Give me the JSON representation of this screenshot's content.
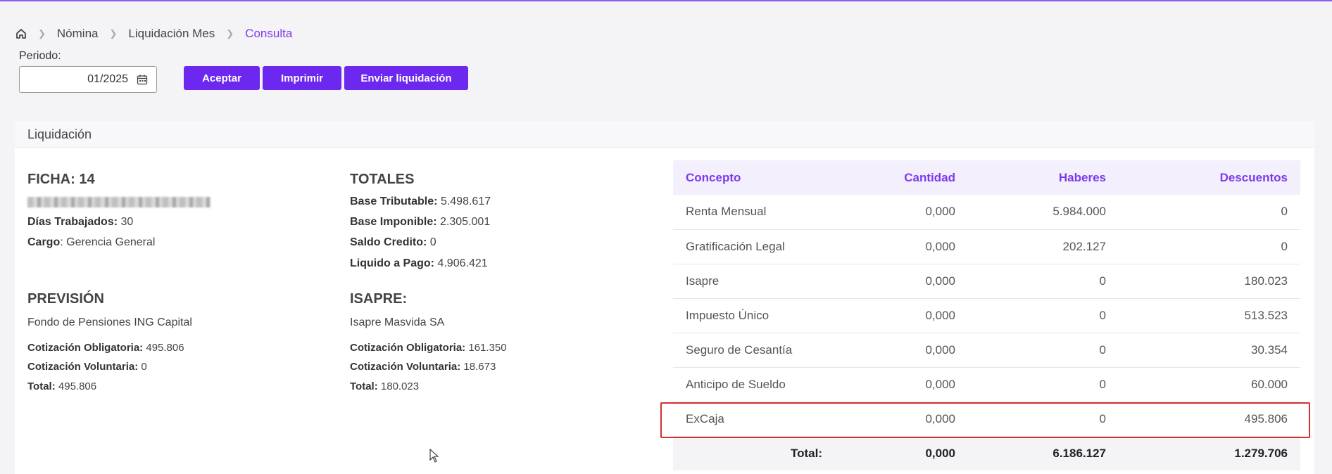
{
  "breadcrumb": {
    "items": [
      "Nómina",
      "Liquidación Mes"
    ],
    "current": "Consulta"
  },
  "periodo": {
    "label": "Periodo:",
    "value": "01/2025"
  },
  "buttons": {
    "aceptar": "Aceptar",
    "imprimir": "Imprimir",
    "enviar": "Enviar liquidación"
  },
  "card": {
    "title": "Liquidación"
  },
  "ficha": {
    "title": "FICHA: 14",
    "dias_label": "Días Trabajados:",
    "dias_value": "30",
    "cargo_label": "Cargo",
    "cargo_value": ": Gerencia General"
  },
  "totales": {
    "title": "TOTALES",
    "base_trib_label": "Base Tributable:",
    "base_trib_value": "5.498.617",
    "base_imp_label": "Base Imponible:",
    "base_imp_value": "2.305.001",
    "saldo_label": "Saldo Credito:",
    "saldo_value": "0",
    "liquido_label": "Liquido a Pago:",
    "liquido_value": "4.906.421"
  },
  "prevision": {
    "title": "PREVISIÓN",
    "name": "Fondo de Pensiones ING Capital",
    "oblig_label": "Cotización Obligatoria:",
    "oblig_value": "495.806",
    "vol_label": "Cotización Voluntaria:",
    "vol_value": "0",
    "total_label": "Total:",
    "total_value": "495.806"
  },
  "isapre": {
    "title": "ISAPRE:",
    "name": "Isapre Masvida SA",
    "oblig_label": "Cotización Obligatoria:",
    "oblig_value": "161.350",
    "vol_label": "Cotización Voluntaria:",
    "vol_value": "18.673",
    "total_label": "Total:",
    "total_value": "180.023"
  },
  "table": {
    "headers": [
      "Concepto",
      "Cantidad",
      "Haberes",
      "Descuentos"
    ],
    "rows": [
      [
        "Renta Mensual",
        "0,000",
        "5.984.000",
        "0"
      ],
      [
        "Gratificación Legal",
        "0,000",
        "202.127",
        "0"
      ],
      [
        "Isapre",
        "0,000",
        "0",
        "180.023"
      ],
      [
        "Impuesto Único",
        "0,000",
        "0",
        "513.523"
      ],
      [
        "Seguro de Cesantía",
        "0,000",
        "0",
        "30.354"
      ],
      [
        "Anticipo de Sueldo",
        "0,000",
        "0",
        "60.000"
      ],
      [
        "ExCaja",
        "0,000",
        "0",
        "495.806"
      ]
    ],
    "footer": [
      "Total:",
      "0,000",
      "6.186.127",
      "1.279.706"
    ]
  },
  "colors": {
    "accent": "#6d28f0",
    "highlight": "#d32f2f"
  }
}
